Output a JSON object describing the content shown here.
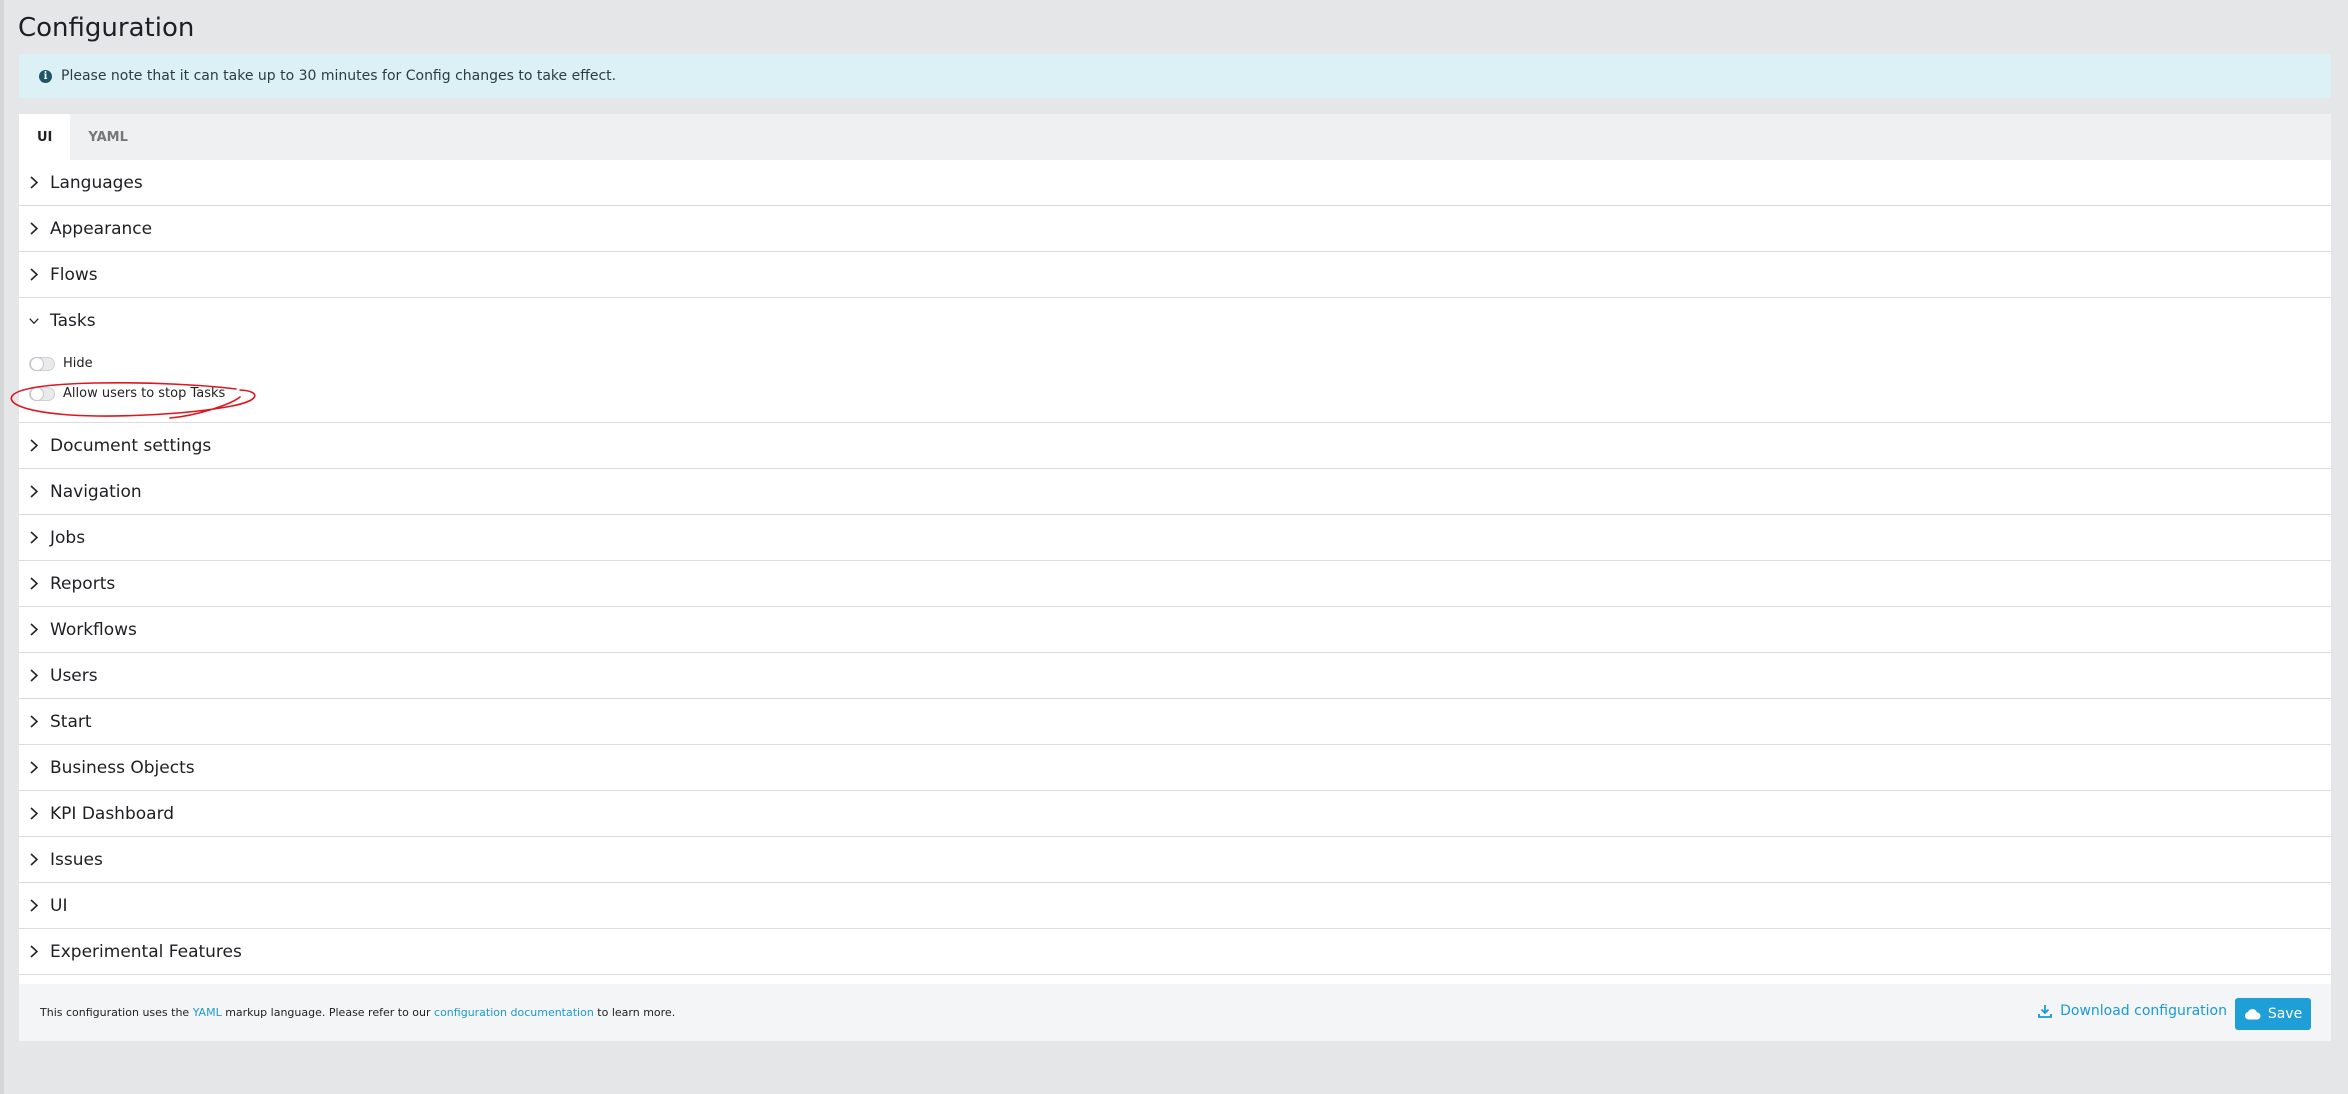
{
  "page": {
    "title": "Configuration"
  },
  "notice": {
    "text": "Please note that it can take up to 30 minutes for Config changes to take effect."
  },
  "tabs": [
    {
      "label": "UI",
      "active": true
    },
    {
      "label": "YAML",
      "active": false
    }
  ],
  "sections": [
    {
      "label": "Languages"
    },
    {
      "label": "Appearance"
    },
    {
      "label": "Flows"
    },
    {
      "label": "Tasks",
      "expanded": true
    },
    {
      "label": "Document settings"
    },
    {
      "label": "Navigation"
    },
    {
      "label": "Jobs"
    },
    {
      "label": "Reports"
    },
    {
      "label": "Workflows"
    },
    {
      "label": "Users"
    },
    {
      "label": "Start"
    },
    {
      "label": "Business Objects"
    },
    {
      "label": "KPI Dashboard"
    },
    {
      "label": "Issues"
    },
    {
      "label": "UI"
    },
    {
      "label": "Experimental Features"
    }
  ],
  "tasks_options": [
    {
      "label": "Hide",
      "enabled": false
    },
    {
      "label": "Allow users to stop Tasks",
      "enabled": false,
      "highlighted": true
    }
  ],
  "footer": {
    "text_1": "This configuration uses the ",
    "yaml_link": "YAML",
    "text_2": " markup language. Please refer to our ",
    "docs_link": "configuration documentation",
    "text_3": " to learn more.",
    "download_label": "Download configuration",
    "save_label": "Save"
  },
  "colors": {
    "accent": "#1e9fd8",
    "notice_bg": "#dcf1f6",
    "annotation": "#e0141e"
  }
}
